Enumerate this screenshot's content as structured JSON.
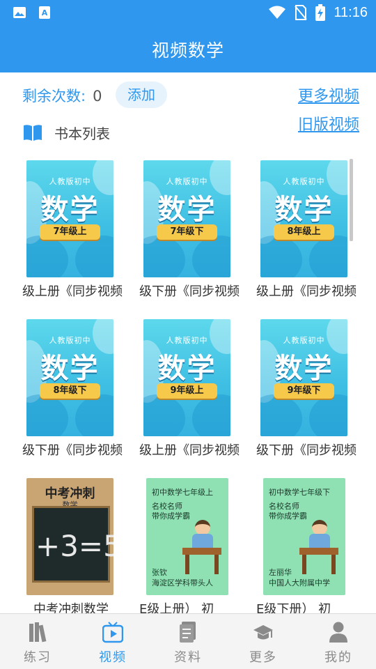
{
  "status_bar": {
    "time": "11:16"
  },
  "app_bar": {
    "title": "视频数学"
  },
  "remaining": {
    "label": "剩余次数:",
    "count": "0",
    "add_label": "添加"
  },
  "links": {
    "more_videos": "更多视频",
    "old_videos": "旧版视频"
  },
  "book_list": {
    "header": "书本列表",
    "books": [
      {
        "caption": "级上册《同步视频",
        "publisher": "人教版初中",
        "subject": "数学",
        "grade": "7年级上"
      },
      {
        "caption": "级下册《同步视频",
        "publisher": "人教版初中",
        "subject": "数学",
        "grade": "7年级下"
      },
      {
        "caption": "级上册《同步视频",
        "publisher": "人教版初中",
        "subject": "数学",
        "grade": "8年级上"
      },
      {
        "caption": "级下册《同步视频",
        "publisher": "人教版初中",
        "subject": "数学",
        "grade": "8年级下"
      },
      {
        "caption": "级上册《同步视频",
        "publisher": "人教版初中",
        "subject": "数学",
        "grade": "9年级上"
      },
      {
        "caption": "级下册《同步视频",
        "publisher": "人教版初中",
        "subject": "数学",
        "grade": "9年级下"
      },
      {
        "caption": "中考冲刺数学",
        "cover_title": "中考冲刺",
        "cover_sub": "数学",
        "equation": "+3=5"
      },
      {
        "caption": "E级上册）      初",
        "cover_title": "初中数学七年级上",
        "line1": "名校名师",
        "line2": "带你成学霸",
        "author1": "张钦",
        "author2": "海淀区学科带头人"
      },
      {
        "caption": "E级下册）      初",
        "cover_title": "初中数学七年级下",
        "line1": "名校名师",
        "line2": "带你成学霸",
        "author1": "左丽华",
        "author2": "中国人大附属中学"
      }
    ]
  },
  "bottom_nav": {
    "tabs": [
      {
        "label": "练习",
        "icon": "books-icon"
      },
      {
        "label": "视频",
        "icon": "tv-play-icon",
        "active": true
      },
      {
        "label": "资料",
        "icon": "document-icon"
      },
      {
        "label": "更多",
        "icon": "graduation-cap-icon"
      },
      {
        "label": "我的",
        "icon": "person-icon"
      }
    ]
  },
  "colors": {
    "primary": "#2f97ee",
    "cover_cyan": "#3fbfe3",
    "grade_badge": "#f7c94a"
  }
}
